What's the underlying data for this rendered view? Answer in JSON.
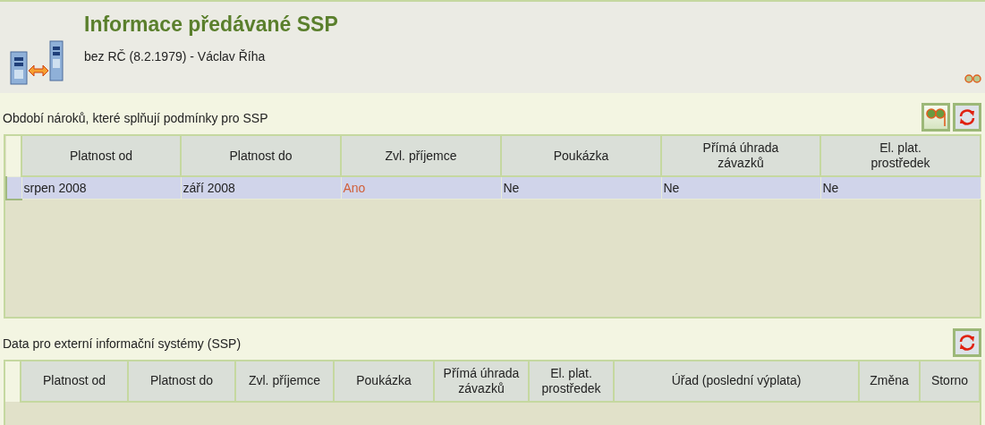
{
  "header": {
    "title": "Informace předávané SSP",
    "subtitle": "bez RČ (8.2.1979) - Václav Říha"
  },
  "sections": [
    {
      "label": "Období nároků, které splňují podmínky pro SSP",
      "buttons": [
        {
          "kind": "view"
        },
        {
          "kind": "refresh"
        }
      ],
      "columns": [
        "Platnost od",
        "Platnost do",
        "Zvl. příjemce",
        "Poukázka",
        "Přímá úhrada závazků",
        "El. plat. prostředek"
      ],
      "rows": [
        {
          "selected": true,
          "cells": [
            {
              "text": "srpen 2008",
              "highlighted": false
            },
            {
              "text": "září 2008",
              "highlighted": false
            },
            {
              "text": "Ano",
              "highlighted": true
            },
            {
              "text": "Ne",
              "highlighted": false
            },
            {
              "text": "Ne",
              "highlighted": false
            },
            {
              "text": "Ne",
              "highlighted": false
            }
          ]
        }
      ]
    },
    {
      "label": "Data pro externí informační systémy (SSP)",
      "buttons": [
        {
          "kind": "refresh"
        }
      ],
      "columns": [
        "Platnost od",
        "Platnost do",
        "Zvl. příjemce",
        "Poukázka",
        "Přímá úhrada závazků",
        "El. plat. prostředek",
        "Úřad (poslední výplata)",
        "Změna",
        "Storno"
      ]
    }
  ]
}
